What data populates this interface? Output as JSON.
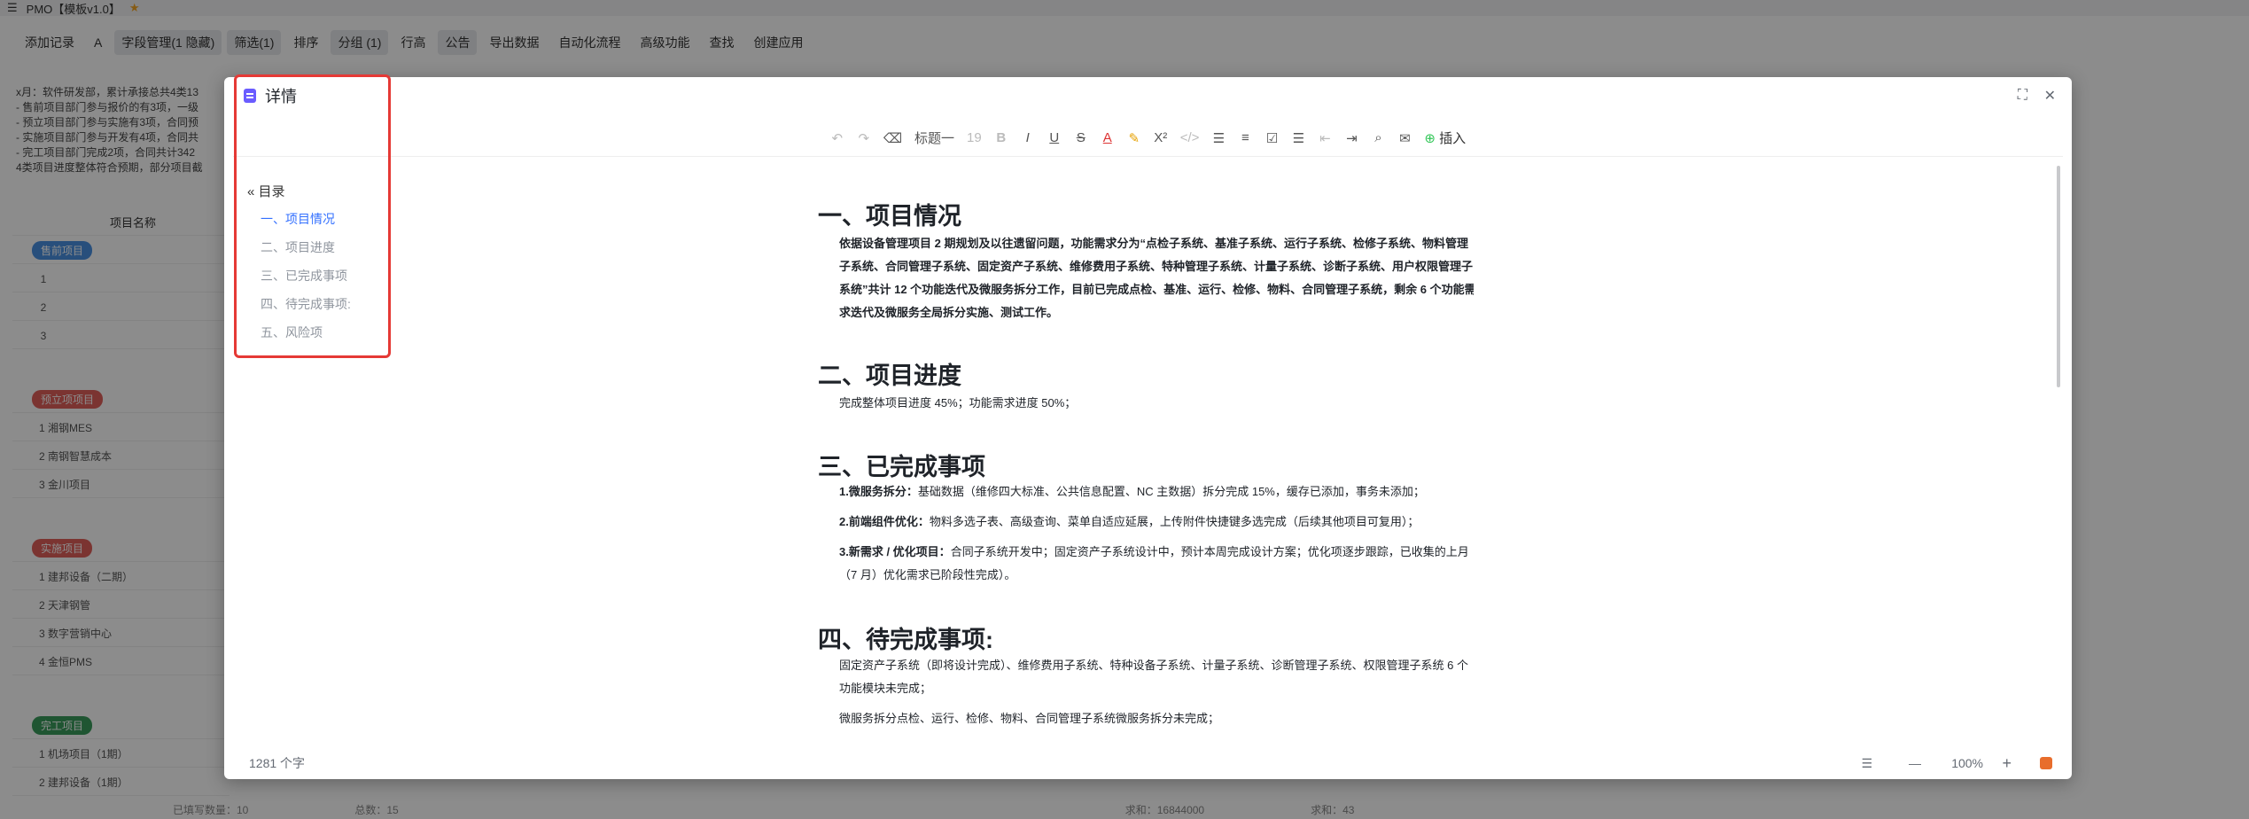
{
  "app": {
    "title": "PMO【模板v1.0】",
    "star": "★",
    "menu": "☰"
  },
  "toolbar": {
    "items": [
      "添加记录",
      "A",
      "字段管理(1 隐藏)",
      "筛选(1)",
      "排序",
      "分组 (1)",
      "行高",
      "公告",
      "导出数据",
      "自动化流程",
      "高级功能",
      "查找",
      "创建应用"
    ]
  },
  "desc": {
    "lines": [
      "x月：软件研发部，累计承接总共4类13",
      "- 售前项目部门参与报价的有3项，一级",
      "- 预立项目部门参与实施有3项，合同预",
      "- 实施项目部门参与开发有4项，合同共",
      "- 完工项目部门完成2项，合同共计342",
      "4类项目进度整体符合预期，部分项目截"
    ]
  },
  "table": {
    "header": "项目名称",
    "groups": [
      {
        "label": "售前项目",
        "color": "#4a90e2",
        "rows": [
          "1",
          "2",
          "3"
        ]
      },
      {
        "label": "预立项项目",
        "color": "#e0605a",
        "rows": [
          "1 湘钢MES",
          "2 南钢智慧成本",
          "3 金川项目"
        ]
      },
      {
        "label": "实施项目",
        "color": "#e0605a",
        "rows": [
          "1 建邦设备（二期）",
          "2 天津钢管",
          "3 数字营销中心",
          "4 金恒PMS"
        ]
      },
      {
        "label": "完工项目",
        "color": "#3a9c5c",
        "rows": [
          "1 机场项目（1期）",
          "2 建邦设备（1期）"
        ]
      }
    ],
    "filled_text": "已填写数"
  },
  "footer": {
    "items": [
      "已填写数量：10",
      "总数：15",
      "求和：16844000",
      "求和：43"
    ]
  },
  "modal": {
    "title": "详情",
    "expand_icon": "⛶",
    "close_icon": "✕",
    "editbar": {
      "undo": "↶",
      "redo": "↷",
      "heading": "标题一",
      "size": "19",
      "bold": "B",
      "italic": "I",
      "underline": "U",
      "strike": "S",
      "color": "A",
      "super": "X²",
      "insert": "插入"
    },
    "toc": {
      "title": "目录",
      "items": [
        "一、项目情况",
        "二、项目进度",
        "三、已完成事项",
        "四、待完成事项:",
        "五、风险项"
      ]
    },
    "content": {
      "h1": "一、项目情况",
      "p1": "依据设备管理项目 2 期规划及以往遗留问题，功能需求分为“点检子系统、基准子系统、运行子系统、检修子系统、物料管理子系统、合同管理子系统、固定资产子系统、维修费用子系统、特种管理子系统、计量子系统、诊断子系统、用户权限管理子系统”共计 12 个功能迭代及微服务拆分工作，目前已完成点检、基准、运行、检修、物料、合同管理子系统，剩余 6 个功能需求迭代及微服务全局拆分实施、测试工作。",
      "h2": "二、项目进度",
      "p2": "完成整体项目进度 45%；功能需求进度 50%；",
      "h3": "三、已完成事项",
      "l1b": "1.微服务拆分：",
      "l1": "基础数据（维修四大标准、公共信息配置、NC 主数据）拆分完成 15%，缓存已添加，事务未添加；",
      "l2b": "2.前端组件优化：",
      "l2": "物料多选子表、高级查询、菜单自适应延展，上传附件快捷键多选完成（后续其他项目可复用）；",
      "l3b": "3.新需求 / 优化项目：",
      "l3": "合同子系统开发中；固定资产子系统设计中，预计本周完成设计方案；优化项逐步跟踪，已收集的上月（7 月）优化需求已阶段性完成）。",
      "h4": "四、待完成事项:",
      "p4": "固定资产子系统（即将设计完成）、维修费用子系统、特种设备子系统、计量子系统、诊断管理子系统、权限管理子系统 6 个功能模块未完成；",
      "p5": "微服务拆分点检、运行、检修、物料、合同管理子系统微服务拆分未完成；"
    },
    "footer": {
      "wordcount": "1281 个字",
      "zoom": "100%",
      "minus": "—",
      "plus": "+"
    }
  }
}
